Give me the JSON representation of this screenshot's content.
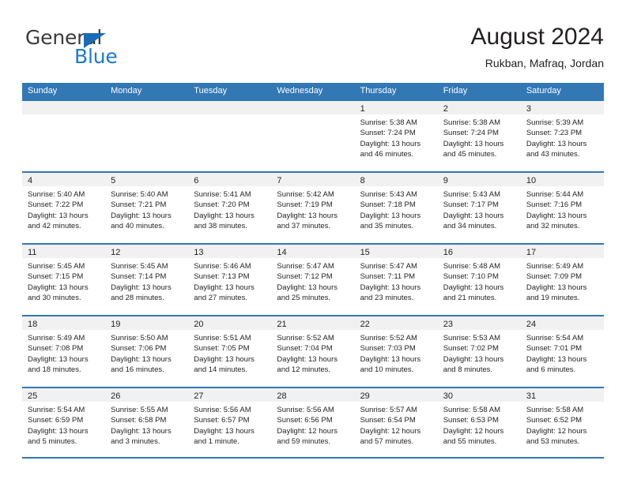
{
  "brand": {
    "name_part1": "General",
    "name_part2": "Blue",
    "triangle_color": "#1a6bb5",
    "blue_color": "#1a7ad4"
  },
  "header": {
    "title": "August 2024",
    "subtitle": "Rukban, Mafraq, Jordan"
  },
  "theme": {
    "header_blue": "#3178b5",
    "day_band_gray": "#f1f1f1",
    "text": "#231f20"
  },
  "weekdays": [
    "Sunday",
    "Monday",
    "Tuesday",
    "Wednesday",
    "Thursday",
    "Friday",
    "Saturday"
  ],
  "weeks": [
    [
      {
        "day": "",
        "sunrise": "",
        "sunset": "",
        "daylight1": "",
        "daylight2": ""
      },
      {
        "day": "",
        "sunrise": "",
        "sunset": "",
        "daylight1": "",
        "daylight2": ""
      },
      {
        "day": "",
        "sunrise": "",
        "sunset": "",
        "daylight1": "",
        "daylight2": ""
      },
      {
        "day": "",
        "sunrise": "",
        "sunset": "",
        "daylight1": "",
        "daylight2": ""
      },
      {
        "day": "1",
        "sunrise": "Sunrise: 5:38 AM",
        "sunset": "Sunset: 7:24 PM",
        "daylight1": "Daylight: 13 hours",
        "daylight2": "and 46 minutes."
      },
      {
        "day": "2",
        "sunrise": "Sunrise: 5:38 AM",
        "sunset": "Sunset: 7:24 PM",
        "daylight1": "Daylight: 13 hours",
        "daylight2": "and 45 minutes."
      },
      {
        "day": "3",
        "sunrise": "Sunrise: 5:39 AM",
        "sunset": "Sunset: 7:23 PM",
        "daylight1": "Daylight: 13 hours",
        "daylight2": "and 43 minutes."
      }
    ],
    [
      {
        "day": "4",
        "sunrise": "Sunrise: 5:40 AM",
        "sunset": "Sunset: 7:22 PM",
        "daylight1": "Daylight: 13 hours",
        "daylight2": "and 42 minutes."
      },
      {
        "day": "5",
        "sunrise": "Sunrise: 5:40 AM",
        "sunset": "Sunset: 7:21 PM",
        "daylight1": "Daylight: 13 hours",
        "daylight2": "and 40 minutes."
      },
      {
        "day": "6",
        "sunrise": "Sunrise: 5:41 AM",
        "sunset": "Sunset: 7:20 PM",
        "daylight1": "Daylight: 13 hours",
        "daylight2": "and 38 minutes."
      },
      {
        "day": "7",
        "sunrise": "Sunrise: 5:42 AM",
        "sunset": "Sunset: 7:19 PM",
        "daylight1": "Daylight: 13 hours",
        "daylight2": "and 37 minutes."
      },
      {
        "day": "8",
        "sunrise": "Sunrise: 5:43 AM",
        "sunset": "Sunset: 7:18 PM",
        "daylight1": "Daylight: 13 hours",
        "daylight2": "and 35 minutes."
      },
      {
        "day": "9",
        "sunrise": "Sunrise: 5:43 AM",
        "sunset": "Sunset: 7:17 PM",
        "daylight1": "Daylight: 13 hours",
        "daylight2": "and 34 minutes."
      },
      {
        "day": "10",
        "sunrise": "Sunrise: 5:44 AM",
        "sunset": "Sunset: 7:16 PM",
        "daylight1": "Daylight: 13 hours",
        "daylight2": "and 32 minutes."
      }
    ],
    [
      {
        "day": "11",
        "sunrise": "Sunrise: 5:45 AM",
        "sunset": "Sunset: 7:15 PM",
        "daylight1": "Daylight: 13 hours",
        "daylight2": "and 30 minutes."
      },
      {
        "day": "12",
        "sunrise": "Sunrise: 5:45 AM",
        "sunset": "Sunset: 7:14 PM",
        "daylight1": "Daylight: 13 hours",
        "daylight2": "and 28 minutes."
      },
      {
        "day": "13",
        "sunrise": "Sunrise: 5:46 AM",
        "sunset": "Sunset: 7:13 PM",
        "daylight1": "Daylight: 13 hours",
        "daylight2": "and 27 minutes."
      },
      {
        "day": "14",
        "sunrise": "Sunrise: 5:47 AM",
        "sunset": "Sunset: 7:12 PM",
        "daylight1": "Daylight: 13 hours",
        "daylight2": "and 25 minutes."
      },
      {
        "day": "15",
        "sunrise": "Sunrise: 5:47 AM",
        "sunset": "Sunset: 7:11 PM",
        "daylight1": "Daylight: 13 hours",
        "daylight2": "and 23 minutes."
      },
      {
        "day": "16",
        "sunrise": "Sunrise: 5:48 AM",
        "sunset": "Sunset: 7:10 PM",
        "daylight1": "Daylight: 13 hours",
        "daylight2": "and 21 minutes."
      },
      {
        "day": "17",
        "sunrise": "Sunrise: 5:49 AM",
        "sunset": "Sunset: 7:09 PM",
        "daylight1": "Daylight: 13 hours",
        "daylight2": "and 19 minutes."
      }
    ],
    [
      {
        "day": "18",
        "sunrise": "Sunrise: 5:49 AM",
        "sunset": "Sunset: 7:08 PM",
        "daylight1": "Daylight: 13 hours",
        "daylight2": "and 18 minutes."
      },
      {
        "day": "19",
        "sunrise": "Sunrise: 5:50 AM",
        "sunset": "Sunset: 7:06 PM",
        "daylight1": "Daylight: 13 hours",
        "daylight2": "and 16 minutes."
      },
      {
        "day": "20",
        "sunrise": "Sunrise: 5:51 AM",
        "sunset": "Sunset: 7:05 PM",
        "daylight1": "Daylight: 13 hours",
        "daylight2": "and 14 minutes."
      },
      {
        "day": "21",
        "sunrise": "Sunrise: 5:52 AM",
        "sunset": "Sunset: 7:04 PM",
        "daylight1": "Daylight: 13 hours",
        "daylight2": "and 12 minutes."
      },
      {
        "day": "22",
        "sunrise": "Sunrise: 5:52 AM",
        "sunset": "Sunset: 7:03 PM",
        "daylight1": "Daylight: 13 hours",
        "daylight2": "and 10 minutes."
      },
      {
        "day": "23",
        "sunrise": "Sunrise: 5:53 AM",
        "sunset": "Sunset: 7:02 PM",
        "daylight1": "Daylight: 13 hours",
        "daylight2": "and 8 minutes."
      },
      {
        "day": "24",
        "sunrise": "Sunrise: 5:54 AM",
        "sunset": "Sunset: 7:01 PM",
        "daylight1": "Daylight: 13 hours",
        "daylight2": "and 6 minutes."
      }
    ],
    [
      {
        "day": "25",
        "sunrise": "Sunrise: 5:54 AM",
        "sunset": "Sunset: 6:59 PM",
        "daylight1": "Daylight: 13 hours",
        "daylight2": "and 5 minutes."
      },
      {
        "day": "26",
        "sunrise": "Sunrise: 5:55 AM",
        "sunset": "Sunset: 6:58 PM",
        "daylight1": "Daylight: 13 hours",
        "daylight2": "and 3 minutes."
      },
      {
        "day": "27",
        "sunrise": "Sunrise: 5:56 AM",
        "sunset": "Sunset: 6:57 PM",
        "daylight1": "Daylight: 13 hours",
        "daylight2": "and 1 minute."
      },
      {
        "day": "28",
        "sunrise": "Sunrise: 5:56 AM",
        "sunset": "Sunset: 6:56 PM",
        "daylight1": "Daylight: 12 hours",
        "daylight2": "and 59 minutes."
      },
      {
        "day": "29",
        "sunrise": "Sunrise: 5:57 AM",
        "sunset": "Sunset: 6:54 PM",
        "daylight1": "Daylight: 12 hours",
        "daylight2": "and 57 minutes."
      },
      {
        "day": "30",
        "sunrise": "Sunrise: 5:58 AM",
        "sunset": "Sunset: 6:53 PM",
        "daylight1": "Daylight: 12 hours",
        "daylight2": "and 55 minutes."
      },
      {
        "day": "31",
        "sunrise": "Sunrise: 5:58 AM",
        "sunset": "Sunset: 6:52 PM",
        "daylight1": "Daylight: 12 hours",
        "daylight2": "and 53 minutes."
      }
    ]
  ]
}
